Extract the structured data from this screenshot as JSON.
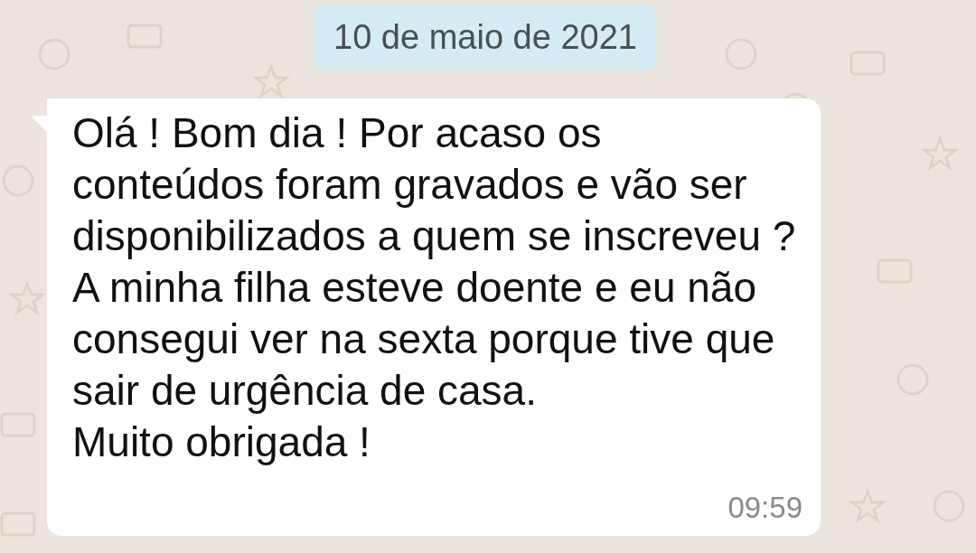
{
  "date_chip": "10 de maio de 2021",
  "messages": [
    {
      "text": "Olá ! Bom dia ! Por acaso os conteúdos foram gravados e vão ser disponibilizados a quem se inscreveu ? A minha filha esteve doente e eu não consegui ver na sexta porque tive que sair de urgência de casa.\nMuito obrigada !",
      "time": "09:59"
    }
  ]
}
